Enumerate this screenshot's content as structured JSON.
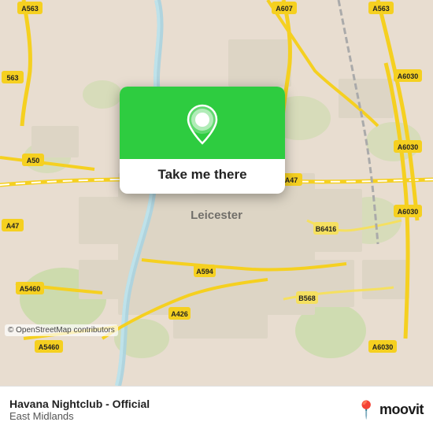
{
  "map": {
    "alt": "OpenStreetMap of Leicester area"
  },
  "popup": {
    "button_label": "Take me there",
    "pin_icon": "location-pin"
  },
  "bottom_bar": {
    "venue_name": "Havana Nightclub - Official",
    "venue_region": "East Midlands",
    "logo_text": "moovit",
    "pin_emoji": "📍"
  },
  "copyright": {
    "text": "© OpenStreetMap contributors"
  },
  "road_labels": {
    "a563_top_left": "A563",
    "a607": "A607",
    "a563_top_right": "A563",
    "a50": "A50",
    "a6030_right": "A6030",
    "a47_left": "A47",
    "a47_mid": "A47",
    "a6030_mid": "A6030",
    "b6416": "B6416",
    "a594": "A594",
    "a426": "A426",
    "a5460_left": "A5460",
    "a5460_bottom": "A5460",
    "b568": "B568",
    "a6030_bottom": "A6030",
    "leicester": "Leicester",
    "s563_left": "563"
  },
  "colors": {
    "green": "#2ecc40",
    "map_bg": "#e8e0d8",
    "road_yellow": "#f5d020",
    "road_white": "#ffffff",
    "water_blue": "#aad3df",
    "green_area": "#b5d29e"
  }
}
